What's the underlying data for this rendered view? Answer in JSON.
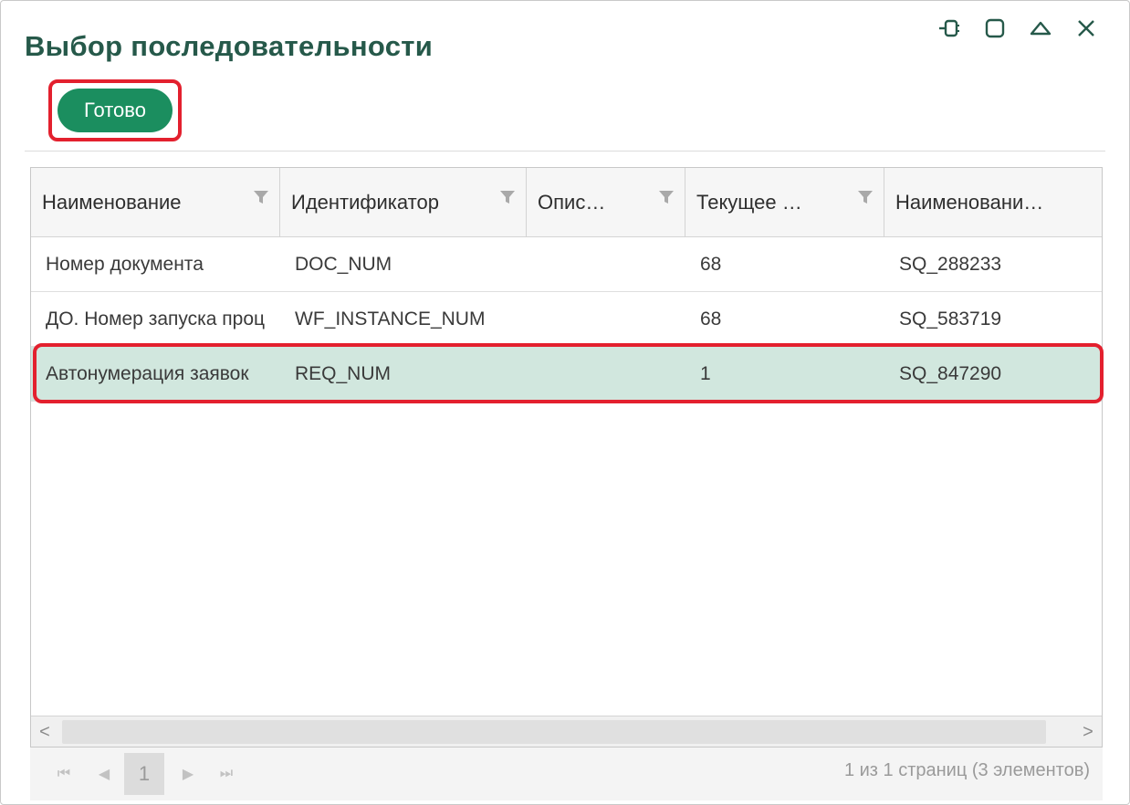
{
  "dialog": {
    "title": "Выбор последовательности",
    "done_label": "Готово",
    "controls": [
      "pin-icon",
      "maximize-icon",
      "collapse-icon",
      "close-icon"
    ]
  },
  "grid": {
    "columns": [
      {
        "label": "Наименование"
      },
      {
        "label": "Идентификатор"
      },
      {
        "label": "Опис…"
      },
      {
        "label": "Текущее …"
      },
      {
        "label": "Наименовани…"
      }
    ],
    "rows": [
      {
        "name": "Номер документа",
        "id": "DOC_NUM",
        "desc": "",
        "current": "68",
        "seq": "SQ_288233"
      },
      {
        "name": "ДО. Номер запуска проц",
        "id": "WF_INSTANCE_NUM",
        "desc": "",
        "current": "68",
        "seq": "SQ_583719"
      },
      {
        "name": "Автонумерация заявок",
        "id": "REQ_NUM",
        "desc": "",
        "current": "1",
        "seq": "SQ_847290"
      }
    ],
    "selected_row": 2
  },
  "scrollbar": {
    "left": "<",
    "right": ">"
  },
  "pager": {
    "first": "⏮",
    "prev": "◀",
    "page": "1",
    "next": "▶",
    "last": "⏭",
    "info": "1 из 1 страниц (3 элементов)"
  },
  "colors": {
    "accent": "#1b8e5f",
    "title": "#26594a",
    "highlight": "#e3202e",
    "selected_row": "#d1e7de"
  }
}
